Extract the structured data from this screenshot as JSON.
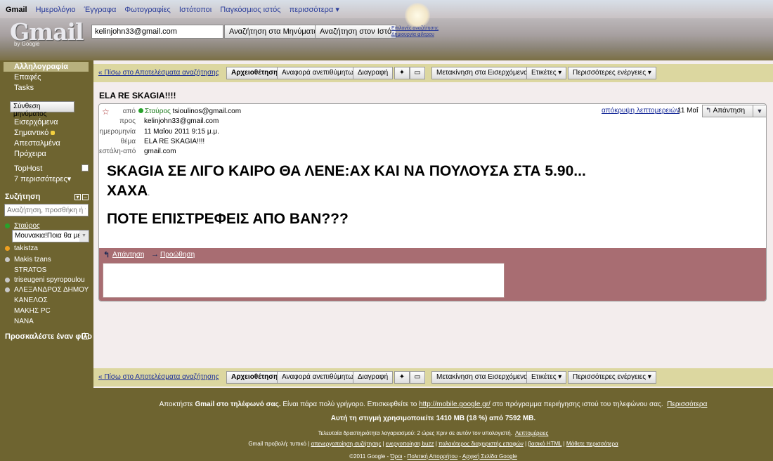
{
  "topnav": {
    "items": [
      "Gmail",
      "Ημερολόγιο",
      "Έγγραφα",
      "Φωτογραφίες",
      "Ιστότοποι",
      "Παγκόσμιος ιστός",
      "περισσότερα ▾"
    ]
  },
  "header": {
    "logo": "Gmail",
    "logo_sub": "by Google",
    "search_value": "kelinjohn33@gmail.com",
    "search_mail_button": "Αναζήτηση στα Μηνύματα",
    "search_web_button": "Αναζήτηση στον Ιστό",
    "search_options": "Επιλογές αναζήτησης",
    "create_filter": "Δημιουργία φίλτρου"
  },
  "sidebar": {
    "mail": "Αλληλογραφία",
    "contacts": "Επαφές",
    "tasks": "Tasks",
    "compose": "Σύνθεση μηνύματος",
    "folders": [
      "Εισερχόμενα",
      "Σημαντικό",
      "Απεσταλμένα",
      "Πρόχειρα"
    ],
    "label_tophost": "TopHost",
    "more": "7 περισσότερες▾",
    "chat_title": "Συζήτηση",
    "chat_search_placeholder": "Αναζήτηση, προσθήκη ή π",
    "self_name": "Σταύρος",
    "status_message": "Μουνακια!Ποια θα με",
    "contacts_list": [
      "takistza",
      "Makis tzans",
      "STRATOS",
      "triseugeni spyropoulou",
      "ΑΛΕΞΑΝΔΡΟΣ ΔΗΜΟΥ",
      "ΚΑΝΕΛΟΣ",
      "ΜΑΚΗΣ PC",
      "NANA"
    ],
    "invite": "Προσκαλέστε έναν φίλο"
  },
  "toolbar": {
    "back": "« Πίσω στο Αποτελέσματα αναζήτησης",
    "archive": "Αρχειοθέτηση",
    "report_spam": "Αναφορά ανεπιθύμητων",
    "delete": "Διαγραφή",
    "move_inbox": "Μετακίνηση στα Εισερχόμενα",
    "labels": "Ετικέτες ▾",
    "more_actions": "Περισσότερες ενέργειες ▾"
  },
  "message": {
    "subject": "ELA RE SKAGIA!!!!",
    "from_label": "από",
    "from_name": "Σταύρος",
    "from_email": "tsioulinos@gmail.com",
    "to_label": "προς",
    "to_value": "kelinjohn33@gmail.com",
    "date_label": "ημερομηνία",
    "date_value": "11 Μαΐου 2011 9:15 μ.μ.",
    "subject_label": "θέμα",
    "subject_value": "ELA RE SKAGIA!!!!",
    "mailedby_label": "εστάλη-από",
    "mailedby_value": "gmail.com",
    "hide_details": "απόκρυψη λεπτομερειών",
    "short_date": "11 Μαΐ",
    "reply_button": "Απάντηση",
    "body_line1": "SKAGIA ΣΕ ΛΙΓΟ ΚΑΙΡΟ ΘΑ ΛΕΝΕ:ΑΧ ΚΑΙ ΝΑ ΠΟΥΛΟΥΣΑ ΣΤΑ 5.90...",
    "body_line2": "ΧΑΧΑ",
    "body_line3": "ΠΟΤΕ ΕΠΙΣΤΡΕΦΕΙΣ ΑΠΟ ΒΑΝ???",
    "reply_link": "Απάντηση",
    "forward_link": "Προώθηση"
  },
  "footer": {
    "mobile_pre": "Αποκτήστε",
    "mobile_gmail": "Gmail στο τηλέφωνό σας.",
    "mobile_mid": "Είναι πάρα πολύ γρήγορο. Επισκεφθείτε το",
    "mobile_url": "http://mobile.google.gr/",
    "mobile_post": "στο πρόγραμμα περιήγησης ιστού του τηλεφώνου σας.",
    "mobile_more": "Περισσότερα",
    "usage": "Αυτή τη στιγμή χρησιμοποιείτε 1410 MB (18 %) από 7592 MB.",
    "last_activity": "Τελευταία δραστηριότητα λογαριασμού: 2 ώρες πριν σε αυτόν τον υπολογιστή.",
    "details": "Λεπτομέρειες",
    "view_label": "Gmail προβολή: τυπικό |",
    "disable_conv": "απενεργοποίηση συζήτησης",
    "enable_buzz": "ενεργοποίηση buzz",
    "old_contacts": "παλαιότερος διαχειριστής επαφών",
    "basic_html": "βασικό HTML",
    "learn_more": "Μάθετε περισσότερα",
    "copyright": "©2011 Google -",
    "terms": "Όροι",
    "privacy": "Πολιτική Απορρήτου",
    "home": "Αρχική Σελίδα Google"
  },
  "colors": {
    "main_bg": "#f3eded",
    "toolbar_bg": "#dcd7a0",
    "reply_area": "#a86d72",
    "page_bg": "#6e6430"
  }
}
